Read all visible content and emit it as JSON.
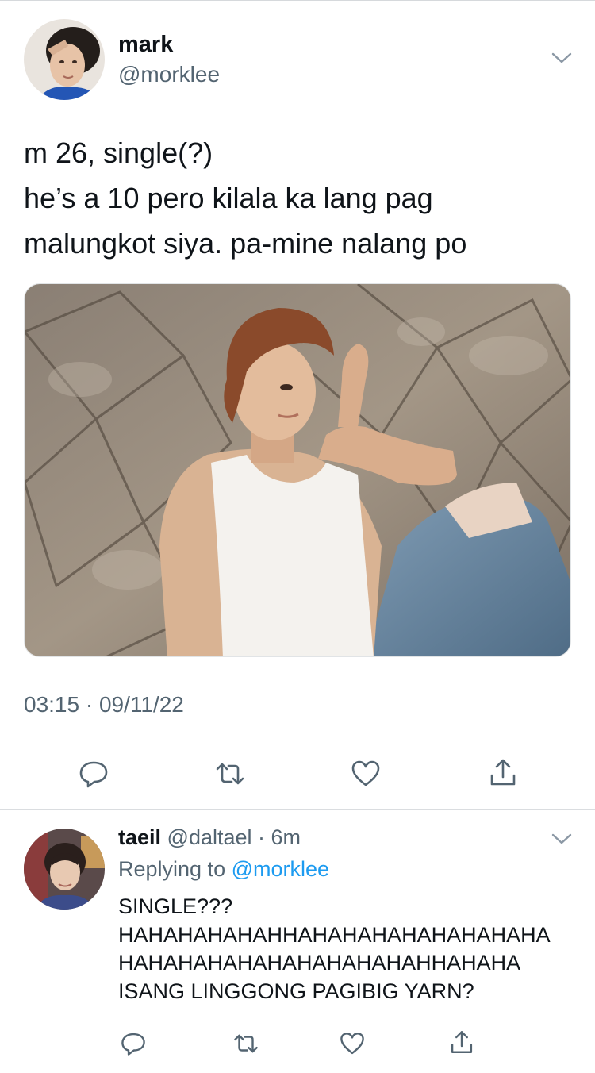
{
  "tweet": {
    "author_name": "mark",
    "author_handle": "@morklee",
    "text_lines": [
      "m 26, single(?)",
      "he’s a 10 pero kilala ka lang pag",
      "malungkot siya. pa-mine nalang po"
    ],
    "timestamp": "03:15 · 09/11/22",
    "avatar_icon": "profile-photo",
    "media_icon": "photo-man-white-tank-top-against-stone-wall"
  },
  "actions": {
    "reply_icon": "reply-icon",
    "retweet_icon": "retweet-icon",
    "like_icon": "heart-icon",
    "share_icon": "share-icon"
  },
  "reply": {
    "author_name": "taeil",
    "author_handle": "@daltael",
    "separator": " · ",
    "age": "6m",
    "replying_prefix": "Replying to ",
    "replying_to": "@morklee",
    "text_lines": [
      "SINGLE???",
      "HAHAHAHAHAHHAHAHAHAHAHAHAHAHA",
      "HAHAHAHAHAHAHAHAHAHAHHAHAHA",
      "ISANG LINGGONG PAGIBIG YARN?"
    ]
  },
  "colors": {
    "text": "#0f1419",
    "secondary": "#536471",
    "link": "#1d9bf0",
    "divider": "#dadde0"
  }
}
